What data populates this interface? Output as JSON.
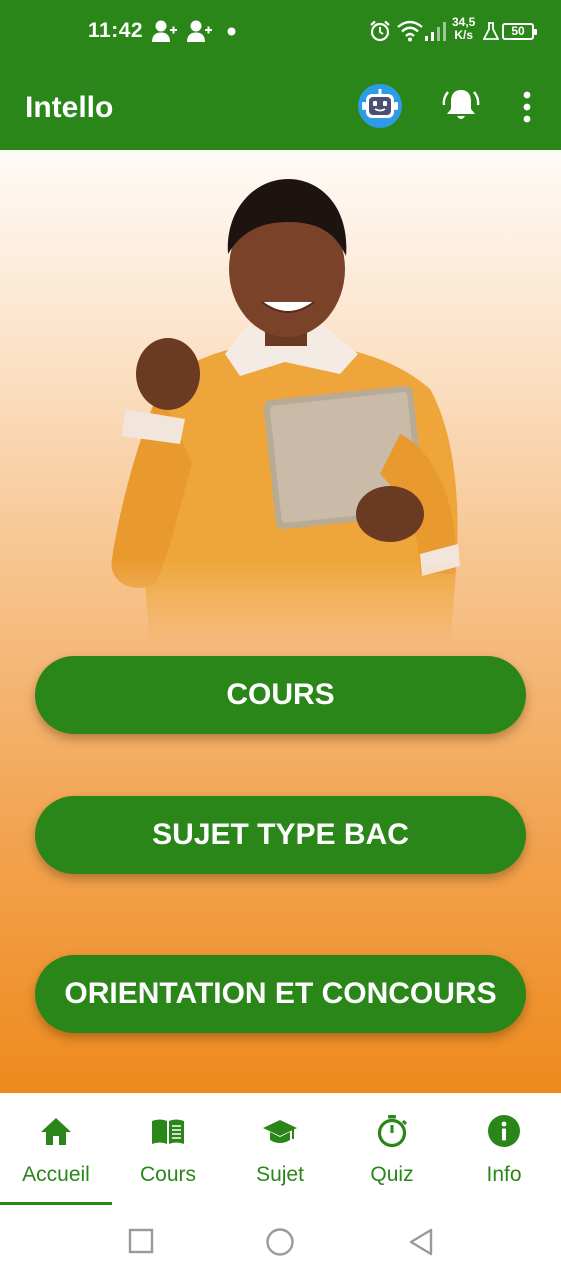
{
  "status_bar": {
    "time": "11:42",
    "net_speed_value": "34,5",
    "net_speed_unit": "K/s",
    "battery": "50",
    "icons": [
      "person-add-icon",
      "person-add-icon",
      "dot-icon",
      "alarm-icon",
      "wifi-icon",
      "signal-icon",
      "flask-icon",
      "battery-icon"
    ]
  },
  "app_bar": {
    "title": "Intello",
    "icons": [
      "robot-icon",
      "bell-ring-icon",
      "more-vert-icon"
    ]
  },
  "main": {
    "buttons": [
      {
        "label": "COURS"
      },
      {
        "label": "SUJET TYPE BAC"
      },
      {
        "label": "ORIENTATION ET CONCOURS"
      }
    ]
  },
  "bottom_nav": {
    "items": [
      {
        "label": "Accueil",
        "icon": "home-icon",
        "active": true
      },
      {
        "label": "Cours",
        "icon": "book-open-icon",
        "active": false
      },
      {
        "label": "Sujet",
        "icon": "graduation-cap-icon",
        "active": false
      },
      {
        "label": "Quiz",
        "icon": "stopwatch-icon",
        "active": false
      },
      {
        "label": "Info",
        "icon": "info-circle-icon",
        "active": false
      }
    ]
  },
  "system_nav": {
    "icons": [
      "recents-square-icon",
      "home-circle-icon",
      "back-triangle-icon"
    ]
  },
  "colors": {
    "primary_green": "#2b861a",
    "accent_orange": "#ee8a1c",
    "bot_blue": "#2e9be6"
  }
}
